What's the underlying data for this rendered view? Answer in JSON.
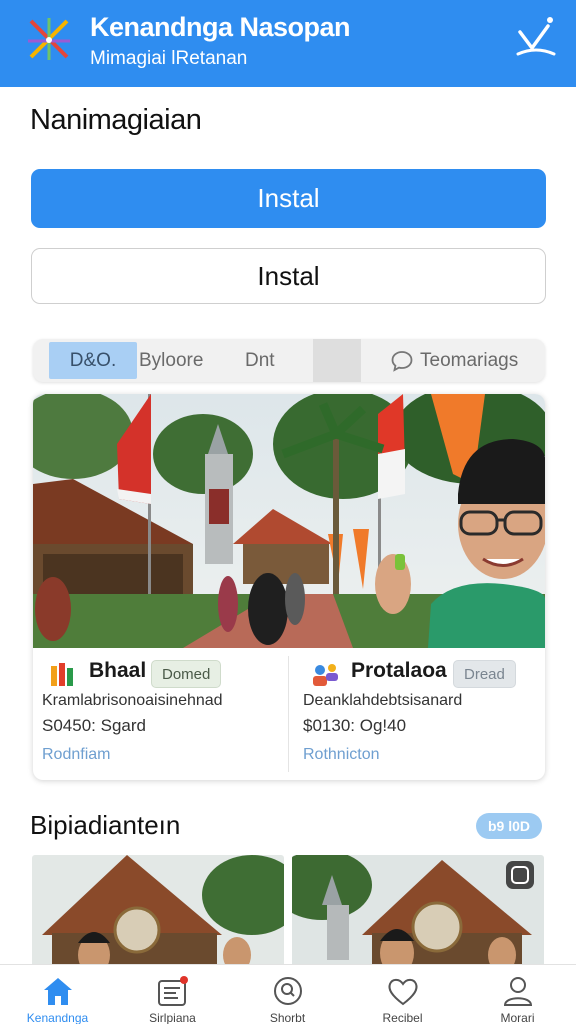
{
  "header": {
    "title": "Kenandnga Nasopan",
    "subtitle": "Mimagiai lRetanan",
    "logo_icon": "star-cross-logo",
    "menu_icon": "checkmark-menu-icon",
    "background": "#2f8df0"
  },
  "main": {
    "heading": "Nanimagiaian",
    "primary_button": "Instal",
    "secondary_button": "Instal",
    "filters": [
      {
        "label": "D&O."
      },
      {
        "label": "Byloore"
      },
      {
        "label": "Dnt"
      },
      {
        "label": "Teomariags",
        "icon": "speech-bubble-icon"
      }
    ],
    "card": {
      "left": {
        "name": "Bhaal",
        "pill": "Domed",
        "description": "Kramlabrisonoaisinehnad",
        "price": "S0450: Sgard",
        "link": "Rodnfiam"
      },
      "right": {
        "name": "Protalaoa",
        "pill": "Dread",
        "description": "Deanklahdebtsisanard",
        "price": "$0130: Og!40",
        "link": "Rothnicton"
      }
    },
    "section2": {
      "heading": "Bipiadianteın",
      "badge": "b9 l0D"
    }
  },
  "tabbar": {
    "items": [
      {
        "label": "Kenandnga",
        "icon": "home-icon",
        "active": true
      },
      {
        "label": "Sirlpiana",
        "icon": "list-icon"
      },
      {
        "label": "Shorbt",
        "icon": "search-icon"
      },
      {
        "label": "Recibel",
        "icon": "heart-icon"
      },
      {
        "label": "Morari",
        "icon": "user-icon"
      }
    ],
    "accent": "#2f8df0"
  }
}
